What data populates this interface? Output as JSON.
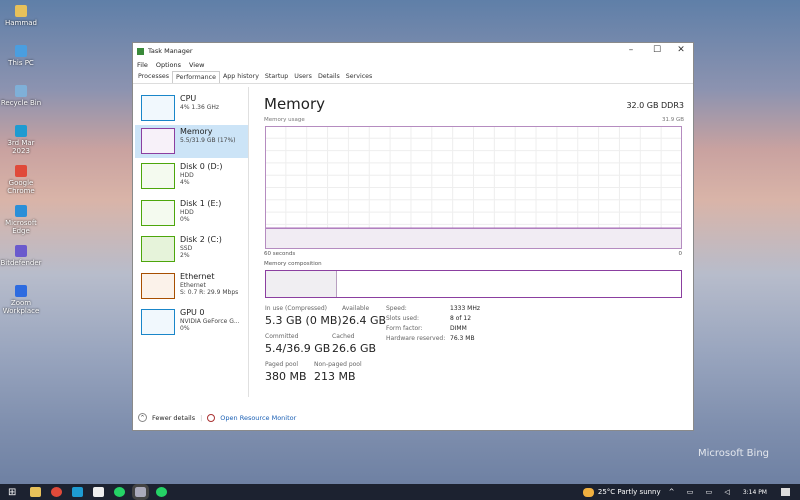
{
  "desktop": {
    "icons": [
      {
        "label": "Hammad",
        "color": "#e8c15a"
      },
      {
        "label": "This PC",
        "color": "#4a9ee0"
      },
      {
        "label": "Recycle Bin",
        "color": "#7fb0d8"
      },
      {
        "label": "3rd Mar 2023",
        "color": "#1e9bd1"
      },
      {
        "label": "Google Chrome",
        "color": "#e04a3a"
      },
      {
        "label": "Microsoft Edge",
        "color": "#2a8fd8"
      },
      {
        "label": "Bitdefender",
        "color": "#6a5acd"
      },
      {
        "label": "Zoom Workplace",
        "color": "#2d6be0"
      }
    ],
    "watermark": "Microsoft Bing"
  },
  "window": {
    "title": "Task Manager",
    "controls": {
      "minimize": "–",
      "maximize": "☐",
      "close": "✕"
    },
    "menu": [
      "File",
      "Options",
      "View"
    ],
    "tabs": [
      "Processes",
      "Performance",
      "App history",
      "Startup",
      "Users",
      "Details",
      "Services"
    ],
    "active_tab": "Performance",
    "sidebar": [
      {
        "name": "CPU",
        "sub1": "4% 1.36 GHz",
        "sub2": "",
        "color": "#1a86c9",
        "fill": "#f1f8fd"
      },
      {
        "name": "Memory",
        "sub1": "5.5/31.9 GB (17%)",
        "sub2": "",
        "color": "#8b3fa0",
        "fill": "#f7f1f9"
      },
      {
        "name": "Disk 0 (D:)",
        "sub1": "HDD",
        "sub2": "4%",
        "color": "#4da60c",
        "fill": "#f4faef"
      },
      {
        "name": "Disk 1 (E:)",
        "sub1": "HDD",
        "sub2": "0%",
        "color": "#4da60c",
        "fill": "#f4faef"
      },
      {
        "name": "Disk 2 (C:)",
        "sub1": "SSD",
        "sub2": "2%",
        "color": "#4da60c",
        "fill": "#e6f3da"
      },
      {
        "name": "Ethernet",
        "sub1": "Ethernet",
        "sub2": "S: 0.7 R: 29.9 Mbps",
        "color": "#a74f01",
        "fill": "#fbf2ea"
      },
      {
        "name": "GPU 0",
        "sub1": "NVIDIA GeForce G...",
        "sub2": "0%",
        "color": "#1a86c9",
        "fill": "#f1f8fd"
      }
    ],
    "main": {
      "title": "Memory",
      "spec": "32.0 GB DDR3",
      "usage_label": "Memory usage",
      "max_label": "31.9 GB",
      "time_left": "60 seconds",
      "time_right": "0",
      "composition_label": "Memory composition",
      "usage_percent": 17,
      "composition_in_use_percent": 17,
      "stats": [
        {
          "label": "In use (Compressed)",
          "value": "5.3 GB (0 MB)"
        },
        {
          "label": "Available",
          "value": "26.4 GB"
        },
        {
          "label": "Committed",
          "value": "5.4/36.9 GB"
        },
        {
          "label": "Cached",
          "value": "26.6 GB"
        },
        {
          "label": "Paged pool",
          "value": "380 MB"
        },
        {
          "label": "Non-paged pool",
          "value": "213 MB"
        }
      ],
      "specs": [
        {
          "k": "Speed:",
          "v": "1333 MHz"
        },
        {
          "k": "Slots used:",
          "v": "8 of 12"
        },
        {
          "k": "Form factor:",
          "v": "DIMM"
        },
        {
          "k": "Hardware reserved:",
          "v": "76.3 MB"
        }
      ]
    },
    "footer": {
      "fewer": "Fewer details",
      "resmon": "Open Resource Monitor"
    }
  },
  "taskbar": {
    "weather": "25°C  Partly sunny",
    "time": "3:14 PM"
  }
}
